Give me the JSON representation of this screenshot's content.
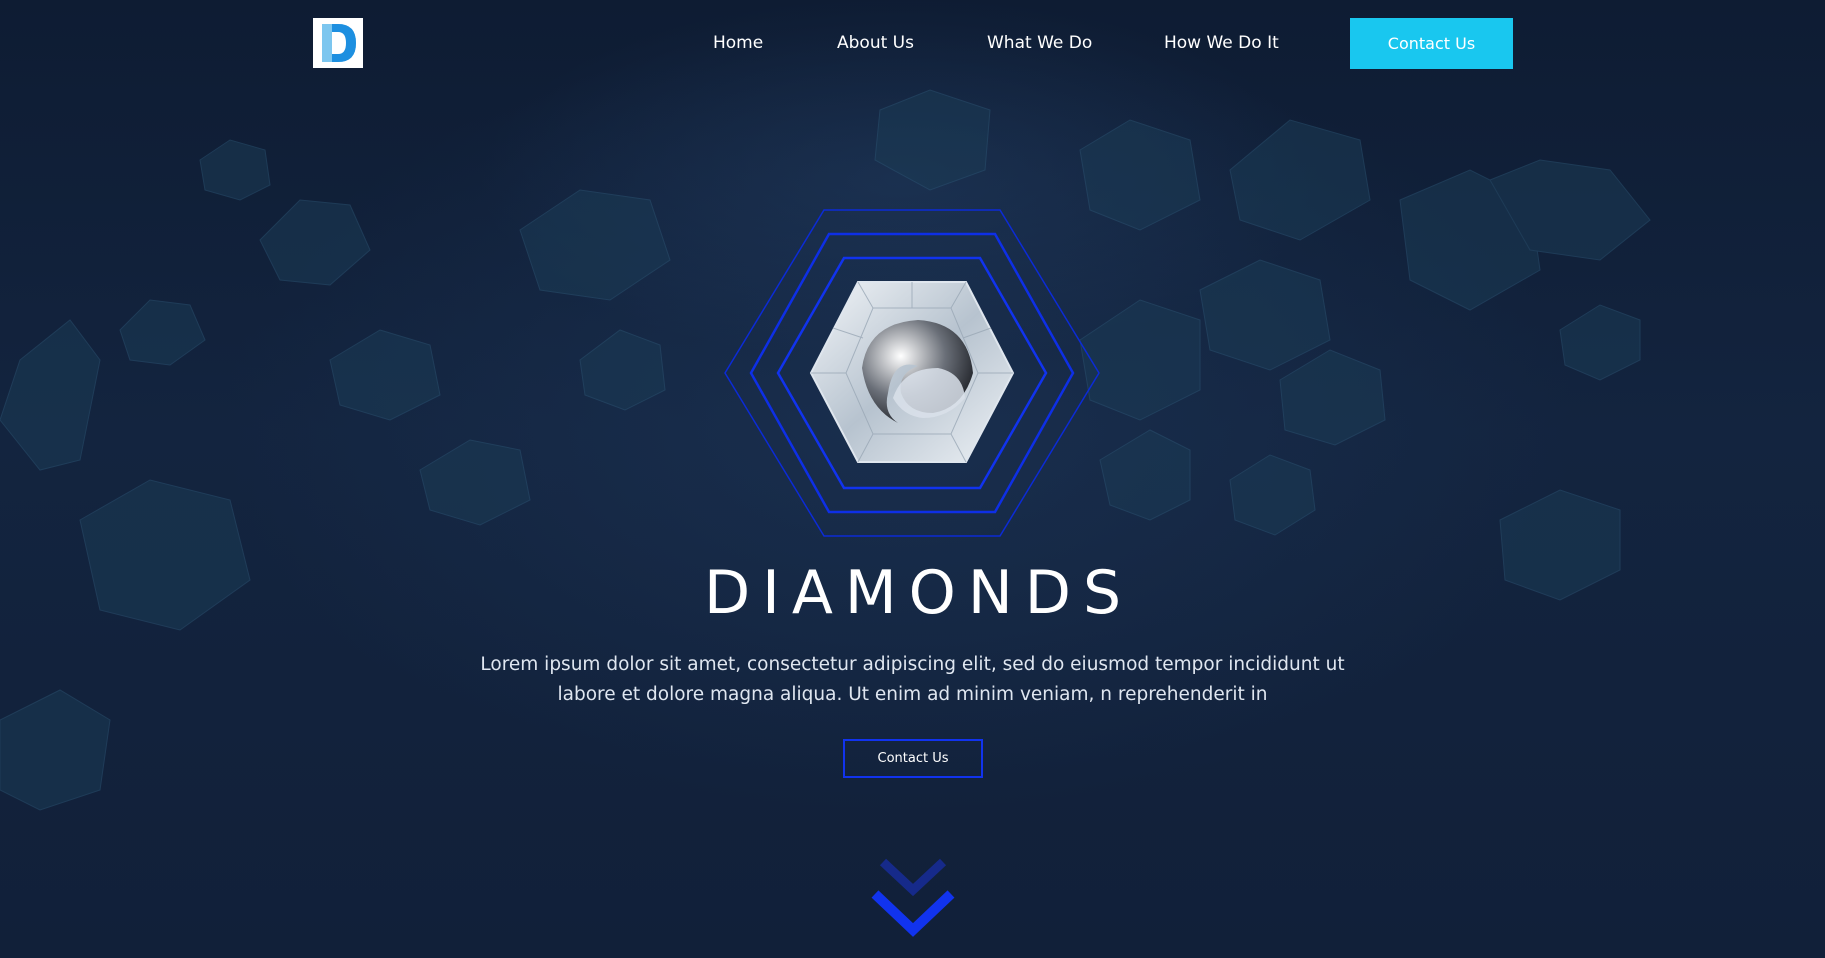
{
  "nav": {
    "logo_letter": "D",
    "links": [
      "Home",
      "About Us",
      "What We Do",
      "How We Do It"
    ],
    "cta_label": "Contact Us"
  },
  "hero": {
    "title": "DIAMONDS",
    "text": "Lorem ipsum dolor sit amet, consectetur adipiscing elit, sed do eiusmod tempor incididunt ut labore et dolore magna aliqua. Ut enim ad minim veniam, n reprehenderit in",
    "cta_label": "Contact Us"
  },
  "icons": [
    "diamond-logo-icon",
    "diamond-emblem-icon",
    "chevron-down-icon"
  ],
  "colors": {
    "background": "#13243f",
    "accent_cyan": "#19c7ef",
    "accent_blue": "#1133ee",
    "text": "#ffffff"
  }
}
